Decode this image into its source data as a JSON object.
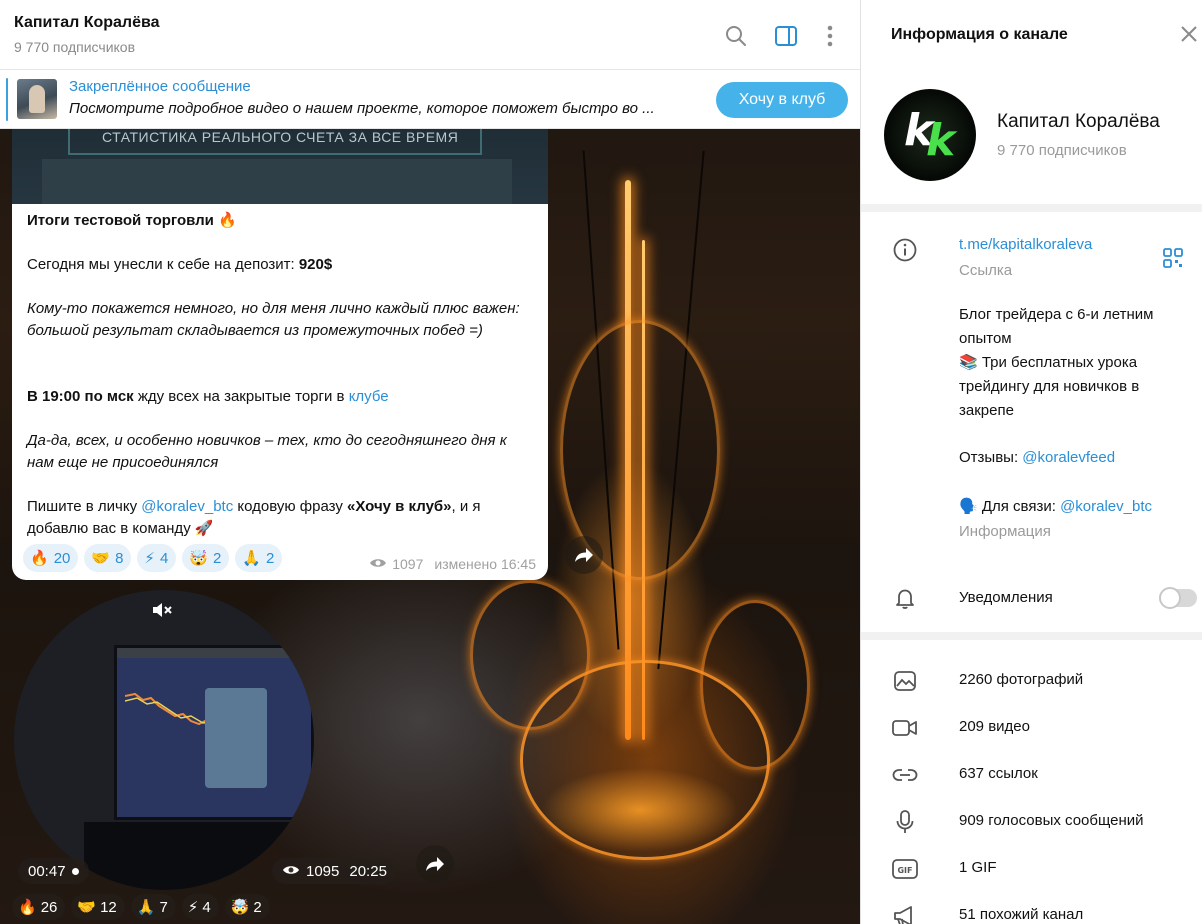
{
  "chat": {
    "title": "Капитал Коралёва",
    "subscribers": "9 770 подписчиков",
    "pinned": {
      "title": "Закреплённое сообщение",
      "text": "Посмотрите подробное видео о нашем проекте, которое поможет быстро во ...",
      "button_label": "Хочу в клуб"
    },
    "media_banner_text": "СТАТИСТИКА РЕАЛЬНОГО СЧЕТА ЗА ВСЕ ВРЕМЯ",
    "message": {
      "title": "Итоги тестовой торговли 🔥",
      "line1_text": "Сегодня мы унесли к себе на депозит: ",
      "line1_amount": "920$",
      "italic1": "Кому-то покажется немного, но для меня лично каждый плюс важен: большой результат складывается из промежуточных побед =)",
      "time_bold": "В 19:00 по мск",
      "time_text": " жду всех на закрытые торги в ",
      "time_link": "клубе",
      "italic2": "Да-да, всех, и особенно новичков – тех, кто до сегодняшнего дня к нам еще не присоединялся",
      "cta_pre": "Пишите в личку ",
      "cta_link": "@koralev_btc",
      "cta_mid": " кодовую фразу ",
      "cta_bold": "«Хочу в клуб»",
      "cta_post": ", и я добавлю вас в команду 🚀",
      "reactions": [
        {
          "emoji": "🔥",
          "count": "20"
        },
        {
          "emoji": "🤝",
          "count": "8"
        },
        {
          "emoji": "⚡",
          "count": "4"
        },
        {
          "emoji": "🤯",
          "count": "2"
        },
        {
          "emoji": "🙏",
          "count": "2"
        }
      ],
      "views": "1097",
      "edited": "изменено 16:45"
    },
    "video": {
      "duration": "00:47",
      "views": "1095",
      "time": "20:25",
      "reactions": [
        {
          "emoji": "🔥",
          "count": "26"
        },
        {
          "emoji": "🤝",
          "count": "12"
        },
        {
          "emoji": "🙏",
          "count": "7"
        },
        {
          "emoji": "⚡",
          "count": "4"
        },
        {
          "emoji": "🤯",
          "count": "2"
        }
      ]
    }
  },
  "info": {
    "title": "Информация о канале",
    "name": "Капитал Коралёва",
    "subscribers": "9 770 подписчиков",
    "link": "t.me/kapitalkoraleva",
    "link_caption": "Ссылка",
    "description1": "Блог трейдера с 6-и летним опытом",
    "description2": "📚 Три бесплатных урока трейдингу для новичков в закрепе",
    "reviews_label": "Отзывы: ",
    "reviews_link": "@koralevfeed",
    "contact_label": "🗣️ Для связи: ",
    "contact_link": "@koralev_btc",
    "contact_caption": "Информация",
    "notifications_label": "Уведомления",
    "notifications_on": false,
    "media_items": [
      {
        "icon": "photo-icon",
        "label": "2260 фотографий"
      },
      {
        "icon": "video-icon",
        "label": "209 видео"
      },
      {
        "icon": "link-icon",
        "label": "637 ссылок"
      },
      {
        "icon": "mic-icon",
        "label": "909 голосовых сообщений"
      },
      {
        "icon": "gif-icon",
        "label": "1 GIF"
      },
      {
        "icon": "megaphone-icon",
        "label": "51 похожий канал"
      }
    ]
  },
  "colors": {
    "accent": "#2b8fd6",
    "button": "#45b3ea",
    "reaction_bg": "#e7f1fa"
  }
}
